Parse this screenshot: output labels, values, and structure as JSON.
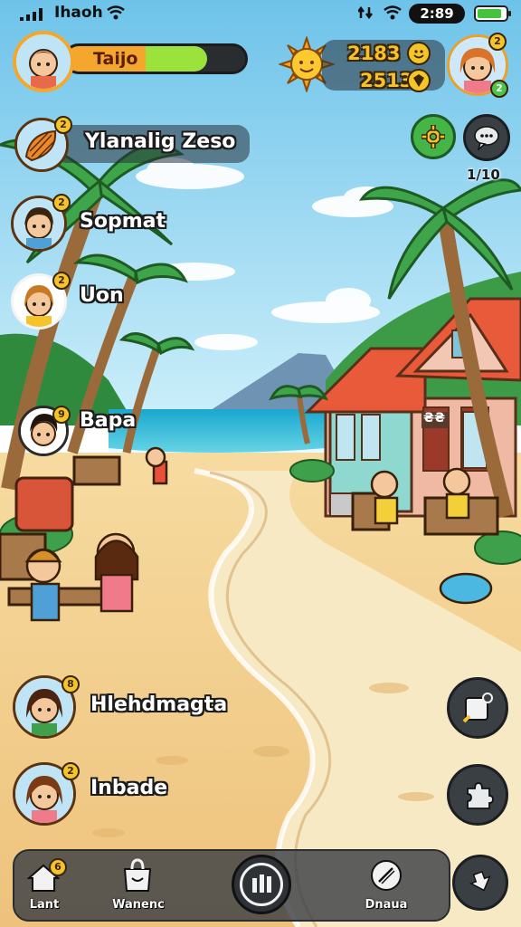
{
  "status_bar": {
    "carrier": "Ihaoh",
    "time": "2:89",
    "battery_level": 0.85
  },
  "top_hud": {
    "player_name": "Taijo",
    "xp_progress": 0.62,
    "currencies": [
      {
        "value": "2183",
        "icon": "smiley-coin-icon"
      },
      {
        "value": "2513",
        "icon": "gem-icon"
      }
    ],
    "sun_icon": "sun-icon"
  },
  "side_actions": {
    "settings_icon": "gear-icon",
    "chat_icon": "chat-bubble-icon",
    "chat_count": "1/10"
  },
  "players": [
    {
      "name": "Ylanalig Zeso",
      "badge": "2",
      "avatar": "shell-avatar"
    },
    {
      "name": "Sopmat",
      "badge": "2",
      "avatar": "boy-avatar"
    },
    {
      "name": "Uon",
      "badge": "2",
      "avatar": "girl-avatar"
    },
    {
      "name": "Bapa",
      "badge": "9",
      "avatar": "boy-avatar"
    },
    {
      "name": "Hlehdmagta",
      "badge": "8",
      "avatar": "girl-avatar"
    },
    {
      "name": "Inbade",
      "badge": "2",
      "avatar": "girl-avatar"
    }
  ],
  "house_sign": "₴₴",
  "right_buttons": [
    {
      "icon": "edit-note-icon"
    },
    {
      "icon": "puzzle-piece-icon"
    },
    {
      "icon": "arrow-down-icon"
    }
  ],
  "bottom_nav": [
    {
      "label": "Lant",
      "icon": "home-icon",
      "badge": "6"
    },
    {
      "label": "Wanenc",
      "icon": "shopping-bag-icon"
    },
    {
      "label": "",
      "icon": "bars-menu-icon"
    },
    {
      "label": "Dnaua",
      "icon": "pencil-icon"
    }
  ],
  "colors": {
    "sky": "#8fd3f0",
    "sea": "#29b6d8",
    "sand": "#f3d08f",
    "xp_bar": "#9be23c",
    "name_pill": "#f4a72c",
    "badge": "#f4c428"
  }
}
